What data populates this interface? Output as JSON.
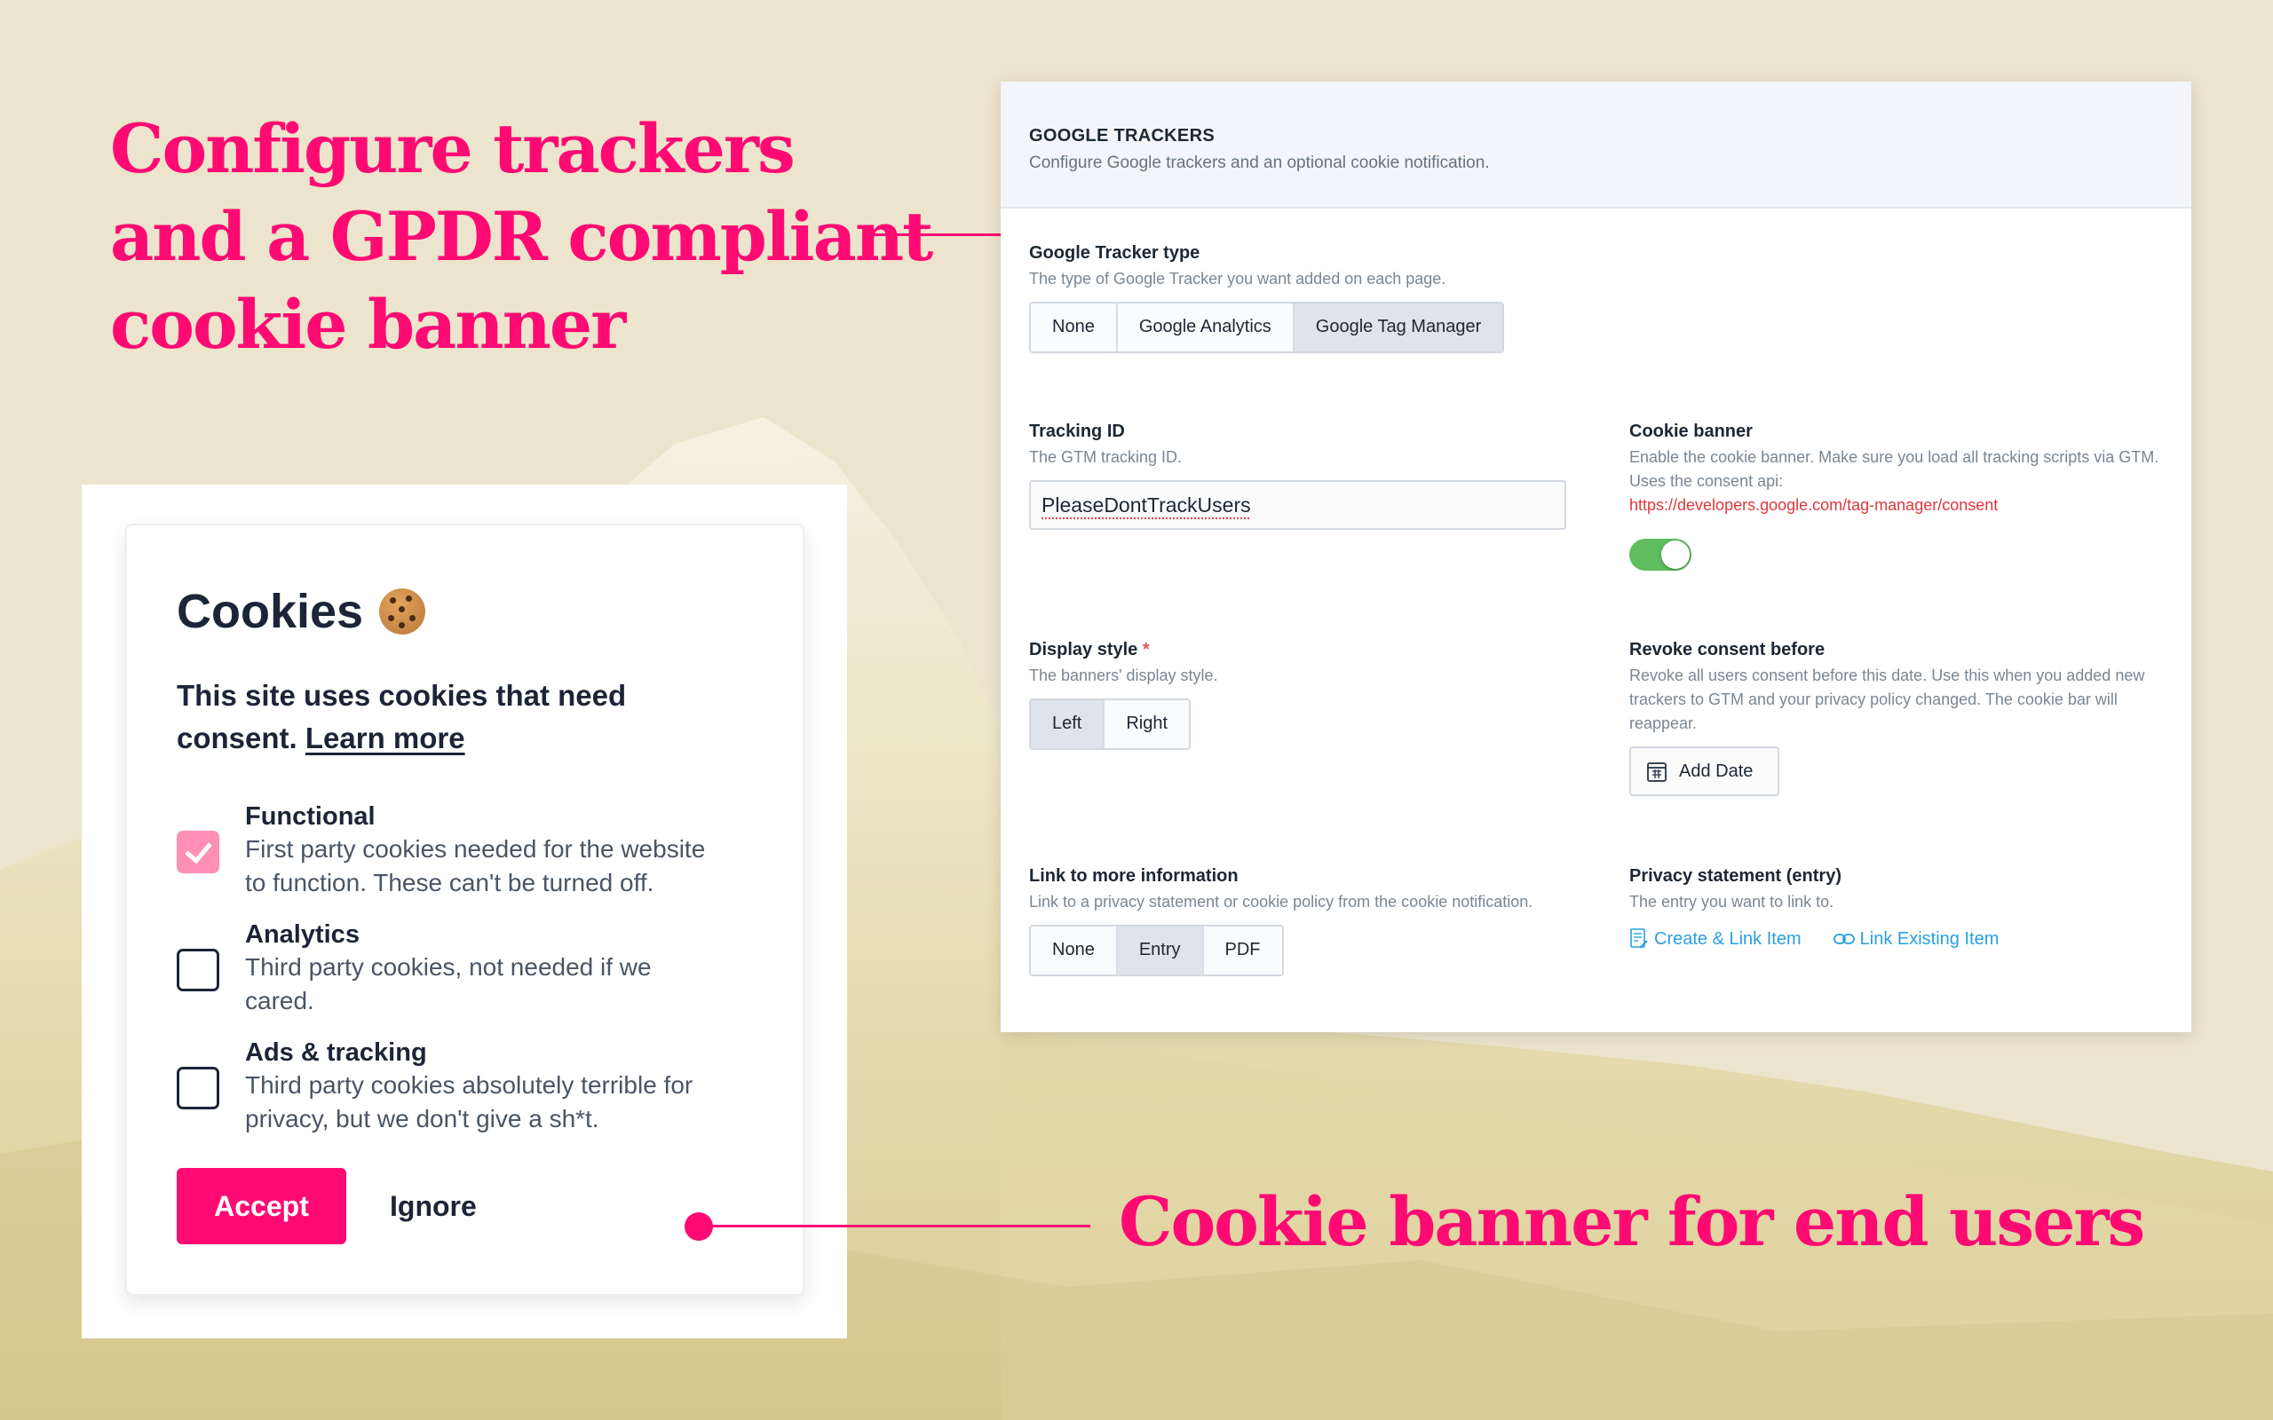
{
  "headline": {
    "lines": [
      "Configure trackers",
      "and a GPDR compliant",
      "cookie banner"
    ]
  },
  "tagline": "Cookie banner for end users",
  "colors": {
    "accent": "#ff0a73",
    "background": "#ede4cd",
    "toggle_on": "#5fbc5f",
    "link": "#2a9fe0",
    "url": "#e0363b"
  },
  "admin": {
    "title": "GOOGLE TRACKERS",
    "subtitle": "Configure Google trackers and an optional cookie notification.",
    "tracker_type": {
      "label": "Google Tracker type",
      "help": "The type of Google Tracker you want added on each page.",
      "options": [
        "None",
        "Google Analytics",
        "Google Tag Manager"
      ],
      "selected": "Google Tag Manager"
    },
    "tracking_id": {
      "label": "Tracking ID",
      "help": "The GTM tracking ID.",
      "value": "PleaseDontTrackUsers"
    },
    "cookie_banner": {
      "label": "Cookie banner",
      "help": "Enable the cookie banner. Make sure you load all tracking scripts via GTM. Uses the consent api:",
      "url": "https://developers.google.com/tag-manager/consent",
      "enabled": true
    },
    "display_style": {
      "label": "Display style",
      "required_mark": "*",
      "help": "The banners' display style.",
      "options": [
        "Left",
        "Right"
      ],
      "selected": "Left"
    },
    "revoke_consent": {
      "label": "Revoke consent before",
      "help": "Revoke all users consent before this date. Use this when you added new trackers to GTM and your privacy policy changed. The cookie bar will reappear.",
      "button": "Add Date"
    },
    "link_more_info": {
      "label": "Link to more information",
      "help": "Link to a privacy statement or cookie policy from the cookie notification.",
      "options": [
        "None",
        "Entry",
        "PDF"
      ],
      "selected": "Entry"
    },
    "privacy_statement": {
      "label": "Privacy statement (entry)",
      "help": "The entry you want to link to.",
      "create_link": "Create & Link Item",
      "existing_link": "Link Existing Item"
    }
  },
  "cookie_banner": {
    "title": "Cookies",
    "intro": "This site uses cookies that need consent.",
    "learn_more": "Learn more",
    "options": [
      {
        "title": "Functional",
        "desc_line1": "First party cookies needed for the website",
        "desc_line2": "to function. These can't be turned off.",
        "checked": true
      },
      {
        "title": "Analytics",
        "desc_line1": "Third party cookies, not needed if we",
        "desc_line2": "cared.",
        "checked": false
      },
      {
        "title": "Ads & tracking",
        "desc_line1": "Third party cookies absolutely terrible for",
        "desc_line2": "privacy, but we don't give a sh*t.",
        "checked": false
      }
    ],
    "accept": "Accept",
    "ignore": "Ignore"
  }
}
